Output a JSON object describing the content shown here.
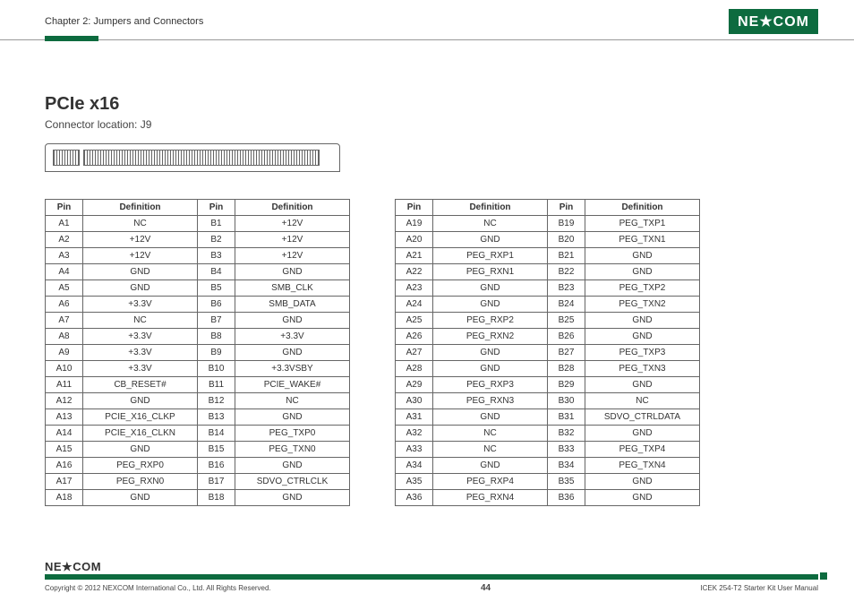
{
  "header": {
    "chapter": "Chapter 2: Jumpers and Connectors",
    "brand": "NE★COM"
  },
  "section": {
    "title": "PCIe x16",
    "subtitle": "Connector location: J9"
  },
  "tableHeaders": {
    "pin": "Pin",
    "definition": "Definition"
  },
  "table1": [
    {
      "pa": "A1",
      "da": "NC",
      "pb": "B1",
      "db": "+12V"
    },
    {
      "pa": "A2",
      "da": "+12V",
      "pb": "B2",
      "db": "+12V"
    },
    {
      "pa": "A3",
      "da": "+12V",
      "pb": "B3",
      "db": "+12V"
    },
    {
      "pa": "A4",
      "da": "GND",
      "pb": "B4",
      "db": "GND"
    },
    {
      "pa": "A5",
      "da": "GND",
      "pb": "B5",
      "db": "SMB_CLK"
    },
    {
      "pa": "A6",
      "da": "+3.3V",
      "pb": "B6",
      "db": "SMB_DATA"
    },
    {
      "pa": "A7",
      "da": "NC",
      "pb": "B7",
      "db": "GND"
    },
    {
      "pa": "A8",
      "da": "+3.3V",
      "pb": "B8",
      "db": "+3.3V"
    },
    {
      "pa": "A9",
      "da": "+3.3V",
      "pb": "B9",
      "db": "GND"
    },
    {
      "pa": "A10",
      "da": "+3.3V",
      "pb": "B10",
      "db": "+3.3VSBY"
    },
    {
      "pa": "A11",
      "da": "CB_RESET#",
      "pb": "B11",
      "db": "PCIE_WAKE#"
    },
    {
      "pa": "A12",
      "da": "GND",
      "pb": "B12",
      "db": "NC"
    },
    {
      "pa": "A13",
      "da": "PCIE_X16_CLKP",
      "pb": "B13",
      "db": "GND"
    },
    {
      "pa": "A14",
      "da": "PCIE_X16_CLKN",
      "pb": "B14",
      "db": "PEG_TXP0"
    },
    {
      "pa": "A15",
      "da": "GND",
      "pb": "B15",
      "db": "PEG_TXN0"
    },
    {
      "pa": "A16",
      "da": "PEG_RXP0",
      "pb": "B16",
      "db": "GND"
    },
    {
      "pa": "A17",
      "da": "PEG_RXN0",
      "pb": "B17",
      "db": "SDVO_CTRLCLK"
    },
    {
      "pa": "A18",
      "da": "GND",
      "pb": "B18",
      "db": "GND"
    }
  ],
  "table2": [
    {
      "pa": "A19",
      "da": "NC",
      "pb": "B19",
      "db": "PEG_TXP1"
    },
    {
      "pa": "A20",
      "da": "GND",
      "pb": "B20",
      "db": "PEG_TXN1"
    },
    {
      "pa": "A21",
      "da": "PEG_RXP1",
      "pb": "B21",
      "db": "GND"
    },
    {
      "pa": "A22",
      "da": "PEG_RXN1",
      "pb": "B22",
      "db": "GND"
    },
    {
      "pa": "A23",
      "da": "GND",
      "pb": "B23",
      "db": "PEG_TXP2"
    },
    {
      "pa": "A24",
      "da": "GND",
      "pb": "B24",
      "db": "PEG_TXN2"
    },
    {
      "pa": "A25",
      "da": "PEG_RXP2",
      "pb": "B25",
      "db": "GND"
    },
    {
      "pa": "A26",
      "da": "PEG_RXN2",
      "pb": "B26",
      "db": "GND"
    },
    {
      "pa": "A27",
      "da": "GND",
      "pb": "B27",
      "db": "PEG_TXP3"
    },
    {
      "pa": "A28",
      "da": "GND",
      "pb": "B28",
      "db": "PEG_TXN3"
    },
    {
      "pa": "A29",
      "da": "PEG_RXP3",
      "pb": "B29",
      "db": "GND"
    },
    {
      "pa": "A30",
      "da": "PEG_RXN3",
      "pb": "B30",
      "db": "NC"
    },
    {
      "pa": "A31",
      "da": "GND",
      "pb": "B31",
      "db": "SDVO_CTRLDATA"
    },
    {
      "pa": "A32",
      "da": "NC",
      "pb": "B32",
      "db": "GND"
    },
    {
      "pa": "A33",
      "da": "NC",
      "pb": "B33",
      "db": "PEG_TXP4"
    },
    {
      "pa": "A34",
      "da": "GND",
      "pb": "B34",
      "db": "PEG_TXN4"
    },
    {
      "pa": "A35",
      "da": "PEG_RXP4",
      "pb": "B35",
      "db": "GND"
    },
    {
      "pa": "A36",
      "da": "PEG_RXN4",
      "pb": "B36",
      "db": "GND"
    }
  ],
  "footer": {
    "logo": "NE★COM",
    "copyright": "Copyright © 2012 NEXCOM International Co., Ltd. All Rights Reserved.",
    "page": "44",
    "docref": "ICEK 254-T2 Starter Kit User Manual"
  }
}
